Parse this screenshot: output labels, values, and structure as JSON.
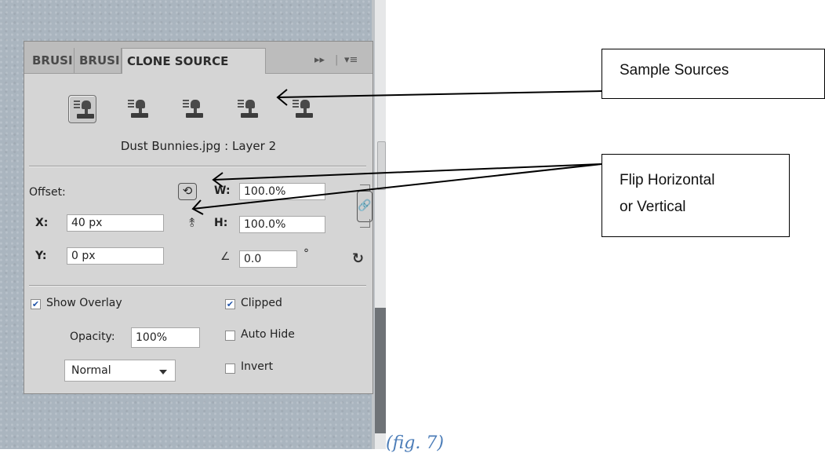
{
  "panel": {
    "tabs": [
      "BRUSI",
      "BRUSI",
      "CLONE SOURCE"
    ],
    "tab_controls": {
      "expand": "▸▸",
      "menu": "▾≡"
    },
    "source_name": "Dust Bunnies.jpg : Layer 2",
    "offset": {
      "label": "Offset:",
      "x_label": "X:",
      "x_value": "40 px",
      "y_label": "Y:",
      "y_value": "0 px"
    },
    "scale": {
      "w_label": "W:",
      "w_value": "100.0%",
      "h_label": "H:",
      "h_value": "100.0%"
    },
    "rotation": {
      "value": "0.0",
      "degree": "°"
    },
    "overlay": {
      "show_overlay": "Show Overlay",
      "opacity_label": "Opacity:",
      "opacity_value": "100%",
      "clipped": "Clipped",
      "auto_hide": "Auto Hide",
      "invert": "Invert",
      "blend_mode": "Normal"
    }
  },
  "callouts": {
    "sample_sources": "Sample Sources",
    "flip_line1": "Flip Horizontal",
    "flip_line2": "or Vertical"
  },
  "caption": "(fig. 7)",
  "icons": [
    "clone-stamp-icon",
    "flip-horizontal-icon",
    "flip-vertical-icon",
    "link-icon",
    "reset-icon",
    "angle-icon",
    "dropdown-caret-icon",
    "checkbox-check-icon"
  ]
}
